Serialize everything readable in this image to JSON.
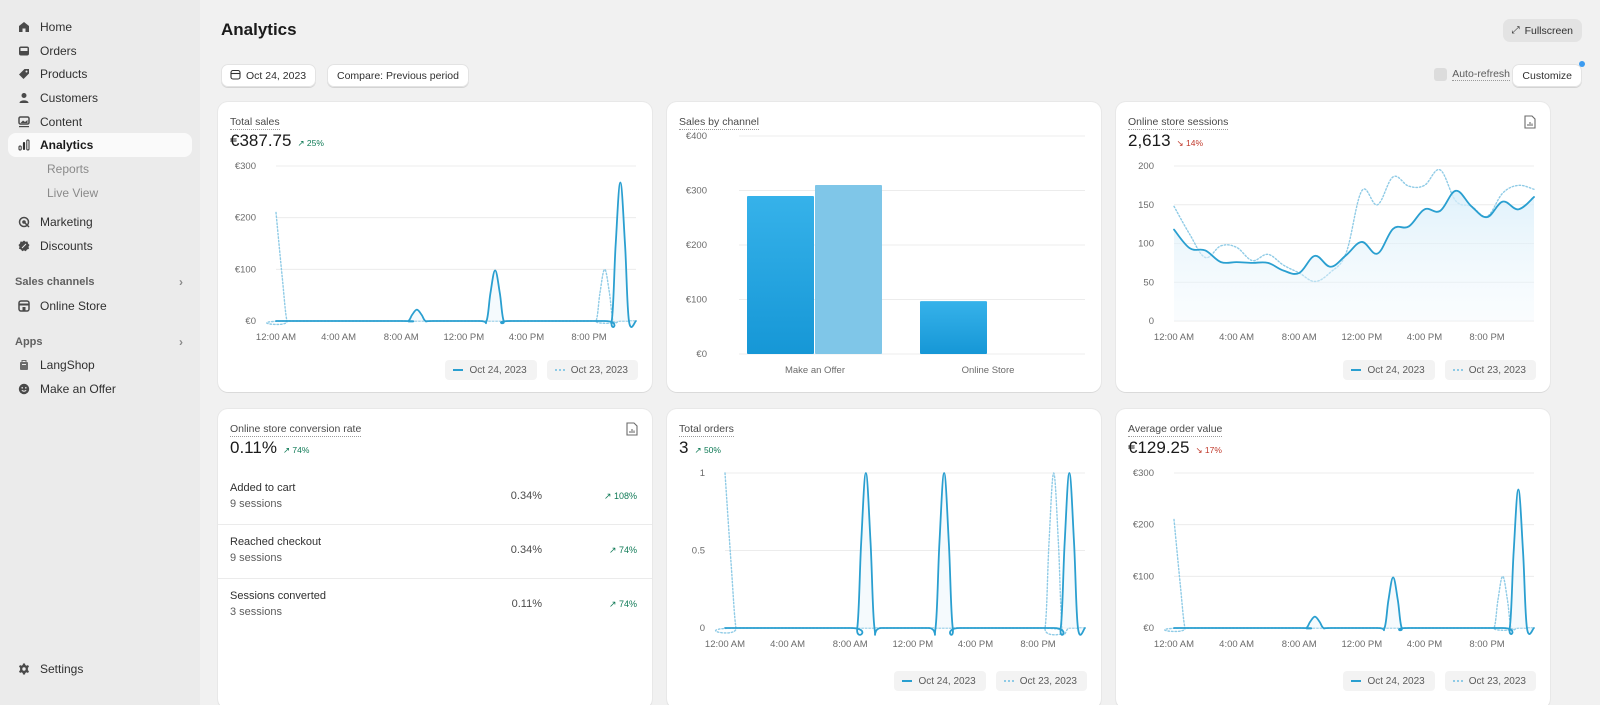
{
  "sidebar": {
    "items": [
      {
        "label": "Home",
        "icon": "home-icon"
      },
      {
        "label": "Orders",
        "icon": "inbox-icon"
      },
      {
        "label": "Products",
        "icon": "tag-icon"
      },
      {
        "label": "Customers",
        "icon": "person-icon"
      },
      {
        "label": "Content",
        "icon": "image-icon"
      },
      {
        "label": "Analytics",
        "icon": "bar-chart-icon",
        "active": true
      },
      {
        "label": "Reports"
      },
      {
        "label": "Live View"
      },
      {
        "label": "Marketing",
        "icon": "target-icon"
      },
      {
        "label": "Discounts",
        "icon": "discount-icon"
      }
    ],
    "sales_channels_label": "Sales channels",
    "online_store_label": "Online Store",
    "apps_label": "Apps",
    "apps": [
      {
        "label": "LangShop",
        "icon": "langshop-icon"
      },
      {
        "label": "Make an Offer",
        "icon": "smile-icon"
      }
    ],
    "settings_label": "Settings"
  },
  "header": {
    "title": "Analytics",
    "date_label": "Oct 24, 2023",
    "compare_label": "Compare: Previous period",
    "fullscreen_label": "Fullscreen",
    "auto_refresh_label": "Auto-refresh",
    "customize_label": "Customize"
  },
  "colors": {
    "primary_series": "#2a9fd0",
    "comparison_series": "#8fcbe6",
    "bar_current": "#1ea0e0",
    "bar_previous": "#7fc6e8",
    "positive": "#0f7a56",
    "negative": "#c0392b"
  },
  "legend": {
    "current": "Oct 24, 2023",
    "previous": "Oct 23, 2023"
  },
  "cards": {
    "total_sales": {
      "title": "Total sales",
      "value": "€387.75",
      "delta": "↗ 25%",
      "trend": "up"
    },
    "sales_by_channel": {
      "title": "Sales by channel"
    },
    "sessions": {
      "title": "Online store sessions",
      "value": "2,613",
      "delta": "↘ 14%",
      "trend": "down"
    },
    "conversion": {
      "title": "Online store conversion rate",
      "value": "0.11%",
      "delta": "↗ 74%",
      "trend": "up",
      "rows": [
        {
          "name": "Added to cart",
          "sessions": "9 sessions",
          "pct": "0.34%",
          "change": "↗ 108%"
        },
        {
          "name": "Reached checkout",
          "sessions": "9 sessions",
          "pct": "0.34%",
          "change": "↗ 74%"
        },
        {
          "name": "Sessions converted",
          "sessions": "3 sessions",
          "pct": "0.11%",
          "change": "↗ 74%"
        }
      ]
    },
    "total_orders": {
      "title": "Total orders",
      "value": "3",
      "delta": "↗ 50%",
      "trend": "up"
    },
    "aov": {
      "title": "Average order value",
      "value": "€129.25",
      "delta": "↘ 17%",
      "trend": "down"
    }
  },
  "chart_data": [
    {
      "id": "total_sales",
      "type": "line",
      "title": "Total sales",
      "x_ticks": [
        "12:00 AM",
        "4:00 AM",
        "8:00 AM",
        "12:00 PM",
        "4:00 PM",
        "8:00 PM"
      ],
      "y_ticks": [
        "€0",
        "€100",
        "€200",
        "€300"
      ],
      "ylim": [
        0,
        300
      ],
      "x_hours": [
        0,
        23
      ],
      "series": [
        {
          "name": "Oct 24, 2023",
          "style": "solid",
          "points": [
            [
              0,
              0
            ],
            [
              8,
              0
            ],
            [
              9,
              22
            ],
            [
              10,
              0
            ],
            [
              13,
              0
            ],
            [
              14,
              98
            ],
            [
              15,
              0
            ],
            [
              21,
              0
            ],
            [
              22,
              268
            ],
            [
              23,
              0
            ]
          ]
        },
        {
          "name": "Oct 23, 2023",
          "style": "dotted",
          "points": [
            [
              0,
              210
            ],
            [
              1,
              0
            ],
            [
              20,
              0
            ],
            [
              21,
              100
            ],
            [
              22,
              0
            ],
            [
              23,
              0
            ]
          ]
        }
      ]
    },
    {
      "id": "sales_by_channel",
      "type": "bar",
      "title": "Sales by channel",
      "categories": [
        "Make an Offer",
        "Online Store"
      ],
      "y_ticks": [
        "€0",
        "€100",
        "€200",
        "€300",
        "€400"
      ],
      "ylim": [
        0,
        400
      ],
      "series": [
        {
          "name": "Oct 24, 2023",
          "values": [
            290,
            97
          ]
        },
        {
          "name": "Oct 23, 2023",
          "values": [
            310,
            0
          ]
        }
      ]
    },
    {
      "id": "sessions",
      "type": "area",
      "title": "Online store sessions",
      "x_ticks": [
        "12:00 AM",
        "4:00 AM",
        "8:00 AM",
        "12:00 PM",
        "4:00 PM",
        "8:00 PM"
      ],
      "y_ticks": [
        "0",
        "50",
        "100",
        "150",
        "200"
      ],
      "ylim": [
        0,
        200
      ],
      "x_hours": [
        0,
        23
      ],
      "series": [
        {
          "name": "Oct 24, 2023",
          "style": "solid",
          "values": [
            118,
            94,
            91,
            76,
            76,
            75,
            75,
            65,
            62,
            84,
            70,
            85,
            102,
            87,
            119,
            122,
            144,
            142,
            168,
            148,
            134,
            154,
            144,
            160
          ]
        },
        {
          "name": "Oct 23, 2023",
          "style": "dotted",
          "values": [
            148,
            112,
            82,
            97,
            95,
            78,
            86,
            72,
            62,
            51,
            63,
            88,
            168,
            150,
            186,
            174,
            175,
            195,
            155,
            148,
            135,
            165,
            175,
            170
          ]
        }
      ]
    },
    {
      "id": "total_orders",
      "type": "line",
      "title": "Total orders",
      "x_ticks": [
        "12:00 AM",
        "4:00 AM",
        "8:00 AM",
        "12:00 PM",
        "4:00 PM",
        "8:00 PM"
      ],
      "y_ticks": [
        "0",
        "0.5",
        "1"
      ],
      "ylim": [
        0,
        1
      ],
      "x_hours": [
        0,
        23
      ],
      "series": [
        {
          "name": "Oct 24, 2023",
          "style": "solid",
          "points": [
            [
              0,
              0
            ],
            [
              8,
              0
            ],
            [
              9,
              1
            ],
            [
              10,
              0
            ],
            [
              13,
              0
            ],
            [
              14,
              1
            ],
            [
              15,
              0
            ],
            [
              21,
              0
            ],
            [
              22,
              1
            ],
            [
              23,
              0
            ]
          ]
        },
        {
          "name": "Oct 23, 2023",
          "style": "dotted",
          "points": [
            [
              0,
              1
            ],
            [
              1,
              0
            ],
            [
              20,
              0
            ],
            [
              21,
              1
            ],
            [
              22,
              0
            ],
            [
              23,
              0
            ]
          ]
        }
      ]
    },
    {
      "id": "aov",
      "type": "line",
      "title": "Average order value",
      "x_ticks": [
        "12:00 AM",
        "4:00 AM",
        "8:00 AM",
        "12:00 PM",
        "4:00 PM",
        "8:00 PM"
      ],
      "y_ticks": [
        "€0",
        "€100",
        "€200",
        "€300"
      ],
      "ylim": [
        0,
        300
      ],
      "x_hours": [
        0,
        23
      ],
      "series": [
        {
          "name": "Oct 24, 2023",
          "style": "solid",
          "points": [
            [
              0,
              0
            ],
            [
              8,
              0
            ],
            [
              9,
              22
            ],
            [
              10,
              0
            ],
            [
              13,
              0
            ],
            [
              14,
              98
            ],
            [
              15,
              0
            ],
            [
              21,
              0
            ],
            [
              22,
              268
            ],
            [
              23,
              0
            ]
          ]
        },
        {
          "name": "Oct 23, 2023",
          "style": "dotted",
          "points": [
            [
              0,
              210
            ],
            [
              1,
              0
            ],
            [
              20,
              0
            ],
            [
              21,
              100
            ],
            [
              22,
              0
            ],
            [
              23,
              0
            ]
          ]
        }
      ]
    }
  ]
}
